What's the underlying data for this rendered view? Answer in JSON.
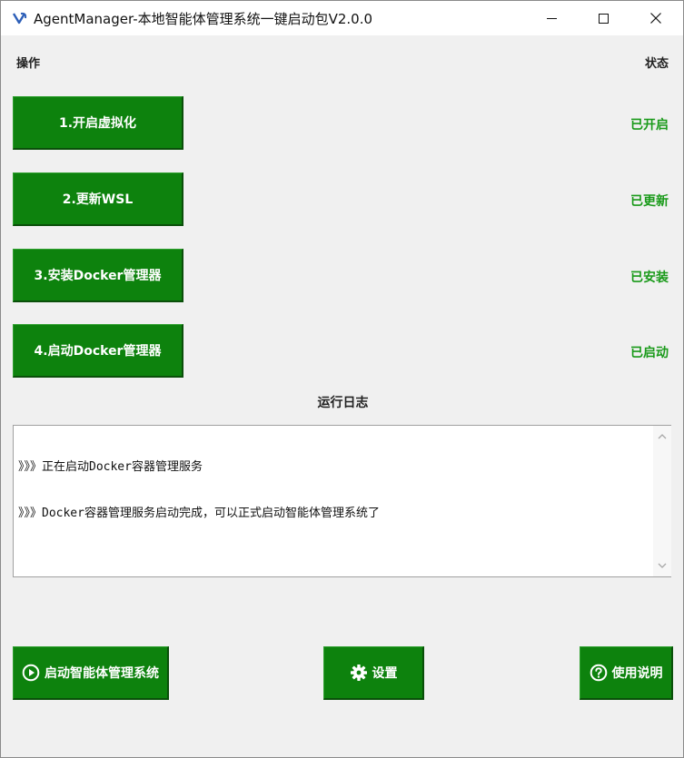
{
  "window": {
    "title": "AgentManager-本地智能体管理系统一键启动包V2.0.0",
    "minimize_glyph": "—",
    "maximize_glyph": "□",
    "close_glyph": "✕"
  },
  "header": {
    "operations_label": "操作",
    "status_label": "状态"
  },
  "steps": [
    {
      "label": "1.开启虚拟化",
      "status": "已开启"
    },
    {
      "label": "2.更新WSL",
      "status": "已更新"
    },
    {
      "label": "3.安装Docker管理器",
      "status": "已安装"
    },
    {
      "label": "4.启动Docker管理器",
      "status": "已启动"
    }
  ],
  "log": {
    "title": "运行日志",
    "lines": [
      "》》》正在启动Docker容器管理服务",
      "》》》Docker容器管理服务启动完成，可以正式启动智能体管理系统了"
    ]
  },
  "actions": {
    "launch_label": "启动智能体管理系统",
    "launch_icon": "play-circle-icon",
    "settings_label": "设置",
    "settings_icon": "gear-icon",
    "help_label": "使用说明",
    "help_icon": "question-circle-icon"
  },
  "colors": {
    "button_green": "#0d820d",
    "status_green": "#1a9a1a"
  }
}
